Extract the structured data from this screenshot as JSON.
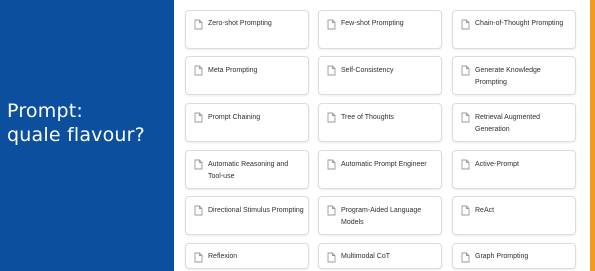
{
  "title": {
    "line1": "Prompt:",
    "line2": "quale flavour?"
  },
  "colors": {
    "panel": "#0b4f9e",
    "accent": "#f29a21",
    "card_border": "#dcdcdc",
    "icon": "#9a9a9a"
  },
  "card_icon": "document-icon",
  "cards": [
    {
      "label": "Zero-shot Prompting"
    },
    {
      "label": "Few-shot Prompting"
    },
    {
      "label": "Chain-of-Thought Prompting"
    },
    {
      "label": "Meta Prompting"
    },
    {
      "label": "Self-Consistency"
    },
    {
      "label": "Generate Knowledge Prompting"
    },
    {
      "label": "Prompt Chaining"
    },
    {
      "label": "Tree of Thoughts"
    },
    {
      "label": "Retrieval Augmented Generation"
    },
    {
      "label": "Automatic Reasoning and Tool-use"
    },
    {
      "label": "Automatic Prompt Engineer"
    },
    {
      "label": "Active-Prompt"
    },
    {
      "label": "Directional Stimulus Prompting"
    },
    {
      "label": "Program-Aided Language Models"
    },
    {
      "label": "ReAct"
    },
    {
      "label": "Reflexion"
    },
    {
      "label": "Multimodal CoT"
    },
    {
      "label": "Graph Prompting"
    }
  ]
}
